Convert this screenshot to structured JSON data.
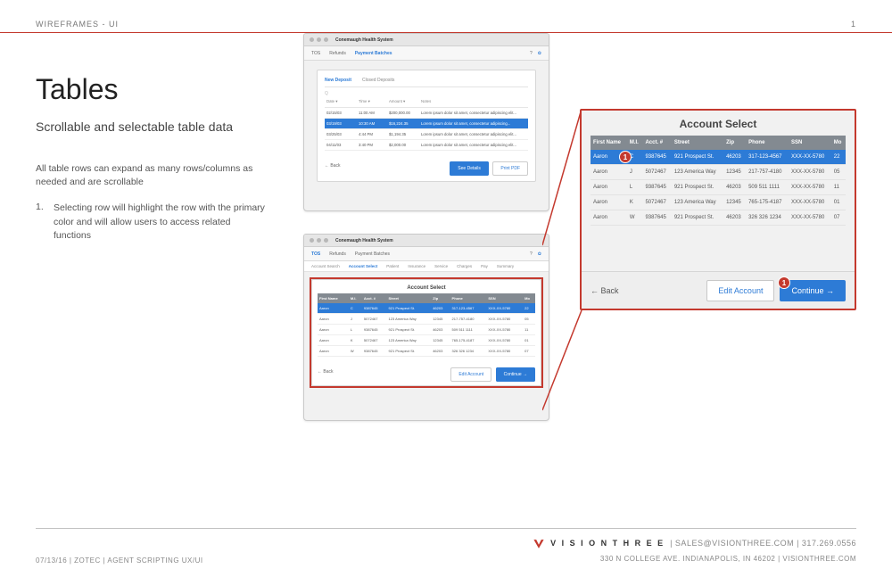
{
  "page": {
    "header": "WIREFRAMES - UI",
    "number": "1"
  },
  "doc": {
    "title": "Tables",
    "subtitle": "Scrollable and selectable table data",
    "body": "All table rows can expand as many rows/columns as needed and are scrollable",
    "bullet_num": "1.",
    "bullet_text": "Selecting row will highlight the row with the primary color and will allow users to access related functions"
  },
  "app": {
    "title": "Conemaugh Health System",
    "toolbar": {
      "tos": "TOS",
      "refunds": "Refunds",
      "payment_batches": "Payment Batches"
    },
    "gear_icon": "gear",
    "help_icon": "help"
  },
  "deposit": {
    "tab_new": "New Deposit",
    "tab_closed": "Closed Deposits",
    "search_placeholder": "Q",
    "head": {
      "date": "Date ▾",
      "time": "Time ▾",
      "amount": "Amount ▾",
      "notes": "Notes"
    },
    "rows": [
      {
        "date": "02/15/03",
        "time": "11:00 AM",
        "amount": "$200,000.00",
        "notes": "Lorem ipsum dolor sit amet, consectetur adipiscing elit..."
      },
      {
        "date": "03/19/03",
        "time": "10:30 AM",
        "amount": "$16,224.35",
        "notes": "Lorem ipsum dolor sit amet, consectetur adipiscing..."
      },
      {
        "date": "03/25/03",
        "time": "4:44 PM",
        "amount": "$1,194.35",
        "notes": "Lorem ipsum dolor sit amet, consectetur adipiscing elit..."
      },
      {
        "date": "04/11/03",
        "time": "3:40 PM",
        "amount": "$2,000.00",
        "notes": "Lorem ipsum dolor sit amet, consectetur adipiscing elit..."
      }
    ],
    "selected": 1,
    "back": "← Back",
    "btn_see": "See Details",
    "btn_print": "Print PDF"
  },
  "subtabs": [
    "Account Search",
    "Account Select",
    "Patient",
    "Insurance",
    "Service",
    "Charges",
    "Pay",
    "Summary"
  ],
  "account": {
    "title": "Account Select",
    "head": {
      "first": "First Name",
      "mi": "M.I.",
      "acct": "Acct. #",
      "street": "Street",
      "zip": "Zip",
      "phone": "Phone",
      "ssn": "SSN",
      "mod": "Mo"
    },
    "rows": [
      {
        "first": "Aaron",
        "mi": "C",
        "acct": "9387645",
        "street": "921 Prospect St.",
        "zip": "46203",
        "phone": "317-123-4567",
        "ssn": "XXX-XX-5780",
        "mod": "22"
      },
      {
        "first": "Aaron",
        "mi": "J",
        "acct": "5072467",
        "street": "123 America Way",
        "zip": "12345",
        "phone": "217-757-4180",
        "ssn": "XXX-XX-5780",
        "mod": "05"
      },
      {
        "first": "Aaron",
        "mi": "L",
        "acct": "9387645",
        "street": "921 Prospect St.",
        "zip": "46203",
        "phone": "509 511 1111",
        "ssn": "XXX-XX-5780",
        "mod": "11"
      },
      {
        "first": "Aaron",
        "mi": "K",
        "acct": "5072467",
        "street": "123 America Way",
        "zip": "12345",
        "phone": "765-175-4187",
        "ssn": "XXX-XX-5780",
        "mod": "01"
      },
      {
        "first": "Aaron",
        "mi": "W",
        "acct": "9387645",
        "street": "921 Prospect St.",
        "zip": "46203",
        "phone": "326 326 1234",
        "ssn": "XXX-XX-5780",
        "mod": "07"
      }
    ],
    "selected": 0,
    "back": "← Back",
    "btn_edit": "Edit Account",
    "btn_continue": "Continue →"
  },
  "footer": {
    "left": "07/13/16  |  ZOTEC  |  AGENT SCRIPTING UX/UI",
    "brand": "V I S I O N   T H R E E",
    "contact": "|  SALES@VISIONTHREE.COM  |  317.269.0556",
    "addr": "330 N COLLEGE AVE. INDIANAPOLIS, IN 46202  |  VISIONTHREE.COM"
  }
}
